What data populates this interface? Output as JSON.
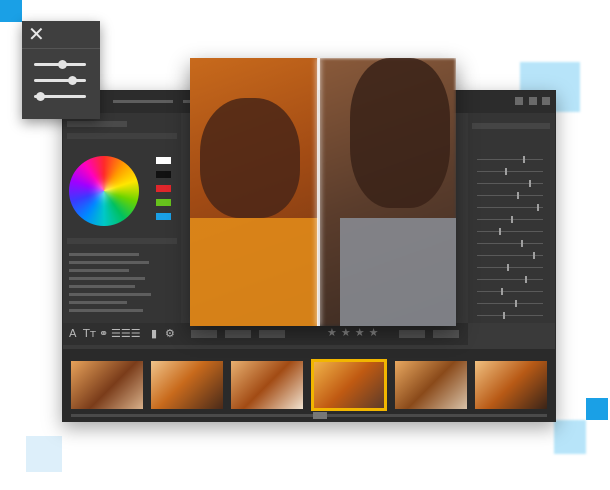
{
  "colors": {
    "accent_blue": "#1aa0e6",
    "selection_yellow": "#f2b600",
    "window_dark": "#3a3a3a"
  },
  "overlay_panel": {
    "close_icon": "close-icon",
    "adjust_icon": "sliders-icon"
  },
  "color_panel": {
    "wheel_icon": "color-wheel",
    "swatches": [
      "#ffffff",
      "#111111",
      "#e0262b",
      "#66c21c",
      "#1aa0e6"
    ]
  },
  "tools": {
    "text_tool": "A",
    "text_size_tool": "Tт",
    "link_icon": "link-icon",
    "align_icon": "align-icon",
    "trash_icon": "trash-icon",
    "settings_icon": "gear-icon"
  },
  "rating": {
    "stars": "★★★★",
    "value": 0,
    "max": 4
  },
  "filmstrip": {
    "thumbnail_count": 6,
    "selected_index": 3
  }
}
